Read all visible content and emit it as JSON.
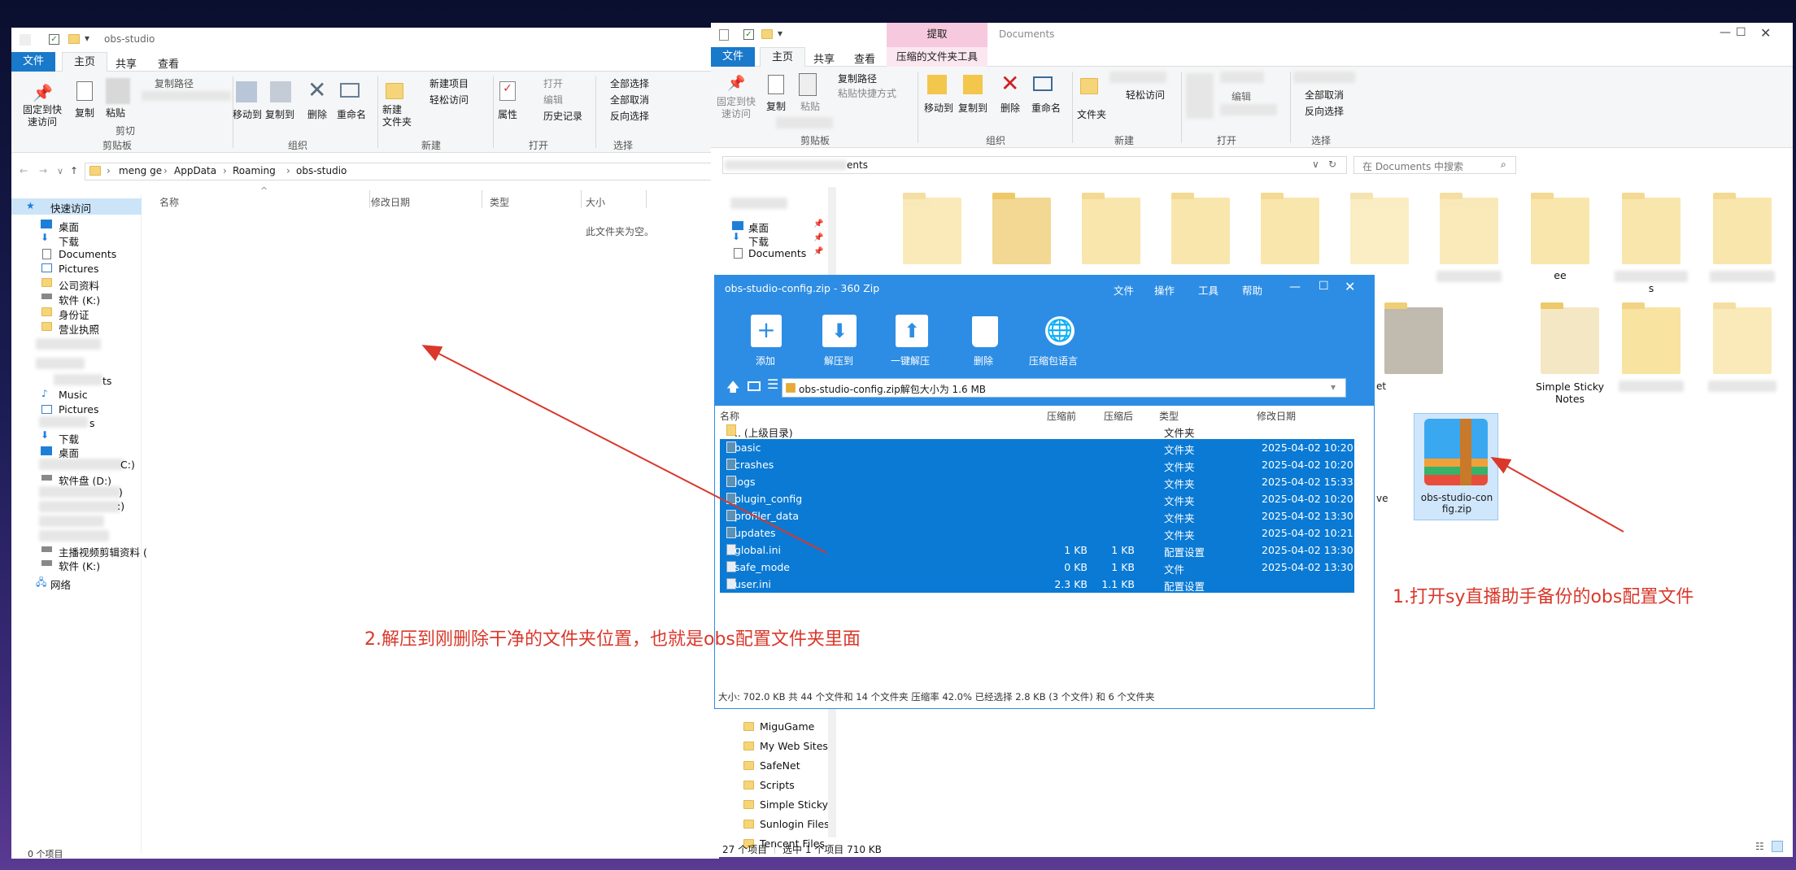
{
  "left": {
    "title": "obs-studio",
    "tabs": [
      "文件",
      "主页",
      "共享",
      "查看"
    ],
    "ribbon": {
      "pin": "固定到快\n速访问",
      "copy": "复制",
      "paste": "粘贴",
      "copy_path": "复制路径",
      "paste_shortcut": "粘贴快捷方式",
      "cut": "剪切",
      "clipboard": "剪贴板",
      "move_to": "移动到",
      "copy_to": "复制到",
      "delete": "删除",
      "rename": "重命名",
      "organize": "组织",
      "new_folder": "新建\n文件夹",
      "new_item": "新建项目",
      "easy_access": "轻松访问",
      "new": "新建",
      "properties": "属性",
      "open": "打开",
      "edit": "编辑",
      "history": "历史记录",
      "open_group": "打开",
      "select_all": "全部选择",
      "select_none": "全部取消",
      "invert": "反向选择",
      "select_group": "选择"
    },
    "path": [
      "meng ge",
      "AppData",
      "Roaming",
      "obs-studio"
    ],
    "columns": [
      "名称",
      "修改日期",
      "类型",
      "大小"
    ],
    "empty": "此文件夹为空。",
    "nav": [
      "快速访问",
      "桌面",
      "下载",
      "Documents",
      "Pictures",
      "公司资料",
      "软件 (K:)",
      "身份证",
      "营业执照",
      "ts",
      "Music",
      "Pictures",
      "s",
      "下载",
      "桌面",
      "C:)",
      "软件盘 (D:)",
      ")",
      ":)",
      "主播视频剪辑资料 (",
      "软件 (K:)",
      "网络"
    ],
    "status": "0 个项目"
  },
  "right": {
    "title": "Documents",
    "extract_tab": "提取",
    "tabs": [
      "文件",
      "主页",
      "共享",
      "查看",
      "压缩的文件夹工具"
    ],
    "ribbon": {
      "pin": "固定到快\n速访问",
      "copy": "复制",
      "paste": "粘贴",
      "copy_path": "复制路径",
      "paste_shortcut": "粘贴快捷方式",
      "clipboard": "剪贴板",
      "move_to": "移动到",
      "copy_to": "复制到",
      "delete": "删除",
      "rename": "重命名",
      "organize": "组织",
      "folder": "文件夹",
      "easy_access": "轻松访问",
      "new": "新建",
      "edit": "编辑",
      "open": "打开",
      "select_none": "全部取消",
      "invert": "反向选择",
      "select": "选择"
    },
    "path_tail": "ents",
    "search_placeholder": "在 Documents 中搜索",
    "nav": [
      "桌面",
      "下载",
      "Documents",
      "MiguGame",
      "My Web Sites",
      "SafeNet",
      "Scripts",
      "Simple Sticky",
      "Sunlogin Files",
      "Tencent Files"
    ],
    "tiles": [
      "ee",
      "s",
      "Simple Sticky\nNotes",
      "et",
      "ve",
      "obs-studio-con\nfig.zip"
    ],
    "status_items": "27 个项目",
    "status_sel": "选中 1 个项目  710 KB"
  },
  "zip": {
    "title": "obs-studio-config.zip - 360 Zip",
    "menu": [
      "文件",
      "操作",
      "工具",
      "帮助"
    ],
    "tools": [
      "添加",
      "解压到",
      "一键解压",
      "删除",
      "压缩包语言"
    ],
    "address": "obs-studio-config.zip解包大小为 1.6 MB",
    "columns": [
      "名称",
      "压缩前",
      "压缩后",
      "类型",
      "修改日期"
    ],
    "rows": [
      {
        "name": ".. (上级目录)",
        "before": "",
        "after": "",
        "type": "文件夹",
        "date": "",
        "sel": false,
        "kind": "up"
      },
      {
        "name": "basic",
        "before": "",
        "after": "",
        "type": "文件夹",
        "date": "2025-04-02 10:20",
        "sel": true,
        "kind": "folder"
      },
      {
        "name": "crashes",
        "before": "",
        "after": "",
        "type": "文件夹",
        "date": "2025-04-02 10:20",
        "sel": true,
        "kind": "folder"
      },
      {
        "name": "logs",
        "before": "",
        "after": "",
        "type": "文件夹",
        "date": "2025-04-02 15:33",
        "sel": true,
        "kind": "folder"
      },
      {
        "name": "plugin_config",
        "before": "",
        "after": "",
        "type": "文件夹",
        "date": "2025-04-02 10:20",
        "sel": true,
        "kind": "folder"
      },
      {
        "name": "profiler_data",
        "before": "",
        "after": "",
        "type": "文件夹",
        "date": "2025-04-02 13:30",
        "sel": true,
        "kind": "folder"
      },
      {
        "name": "updates",
        "before": "",
        "after": "",
        "type": "文件夹",
        "date": "2025-04-02 10:21",
        "sel": true,
        "kind": "folder"
      },
      {
        "name": "global.ini",
        "before": "1 KB",
        "after": "1 KB",
        "type": "配置设置",
        "date": "2025-04-02 13:30",
        "sel": true,
        "kind": "file"
      },
      {
        "name": "safe_mode",
        "before": "0 KB",
        "after": "1 KB",
        "type": "文件",
        "date": "2025-04-02 13:30",
        "sel": true,
        "kind": "file"
      },
      {
        "name": "user.ini",
        "before": "2.3 KB",
        "after": "1.1 KB",
        "type": "配置设置",
        "date": "",
        "sel": true,
        "kind": "file"
      }
    ],
    "status": "大小: 702.0 KB 共 44 个文件和 14 个文件夹 压缩率 42.0% 已经选择 2.8 KB (3 个文件) 和 6 个文件夹"
  },
  "annotations": {
    "one": "1.打开sy直播助手备份的obs配置文件",
    "two": "2.解压到刚删除干净的文件夹位置，也就是obs配置文件夹里面"
  },
  "colors": {
    "accent": "#1e7fd8",
    "zip_blue": "#2d8de4",
    "annot": "#d9382b",
    "select": "#0a7ad4"
  }
}
